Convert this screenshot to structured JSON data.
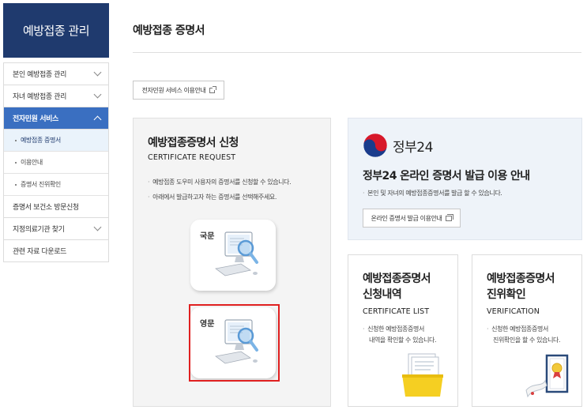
{
  "sidebar": {
    "title": "예방접종 관리",
    "items": [
      {
        "label": "본인 예방접종 관리"
      },
      {
        "label": "자녀 예방접종 관리"
      },
      {
        "label": "전자민원 서비스"
      },
      {
        "label": "증명서 보건소 방문신청"
      },
      {
        "label": "지정의료기관 찾기"
      },
      {
        "label": "관련 자료 다운로드"
      }
    ],
    "subitems": [
      {
        "label": "예방접종 증명서"
      },
      {
        "label": "이용안내"
      },
      {
        "label": "증명서 진위확인"
      }
    ]
  },
  "main": {
    "title": "예방접종 증명서",
    "service_guide_label": "전자민원 서비스 이용안내"
  },
  "request": {
    "title": "예방접종증명서 신청",
    "subtitle": "CERTIFICATE REQUEST",
    "desc": [
      "예방접종 도우미 사용자의 증명서를 신청할 수 있습니다.",
      "아래에서 발급하고자 하는 증명서를 선택해주세요."
    ],
    "korean_label": "국문",
    "english_label": "영문"
  },
  "gov24": {
    "logo_text": "정부24",
    "title": "정부24 온라인 증명서 발급 이용 안내",
    "desc": "본인 및 자녀의 예방접종증명서를 발급 할 수 있습니다.",
    "button_label": "온라인 증명서 발급 이용안내"
  },
  "cards": {
    "list": {
      "title_line1": "예방접종증명서",
      "title_line2": "신청내역",
      "subtitle": "CERTIFICATE LIST",
      "desc_line1": "신청한 예방접종증명서",
      "desc_line2": "내역을 확인할 수 있습니다."
    },
    "verify": {
      "title_line1": "예방접종증명서",
      "title_line2": "진위확인",
      "subtitle": "VERIFICATION",
      "desc_line1": "신청한 예방접종증명서",
      "desc_line2": "진위확인을 할 수 있습니다."
    }
  },
  "colors": {
    "navy": "#1f3a6e",
    "accent_blue": "#3a6fc1",
    "highlight_red": "#e02020"
  }
}
